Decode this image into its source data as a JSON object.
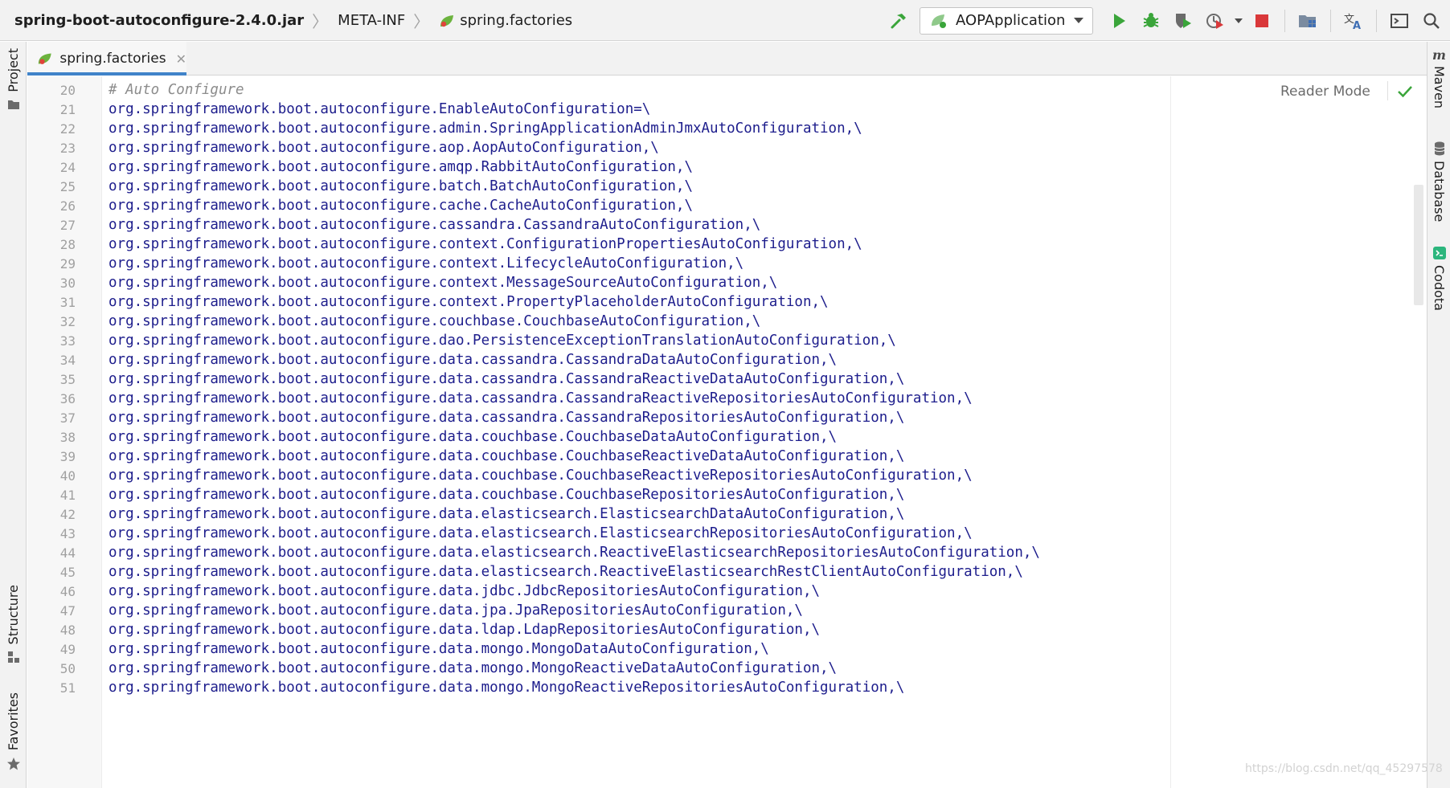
{
  "breadcrumb": {
    "items": [
      {
        "label": "spring-boot-autoconfigure-2.4.0.jar"
      },
      {
        "label": "META-INF"
      },
      {
        "label": "spring.factories"
      }
    ]
  },
  "toolbar": {
    "run_config": "AOPApplication"
  },
  "left_strip": {
    "project": "Project",
    "structure": "Structure",
    "favorites": "Favorites"
  },
  "right_strip": {
    "maven": "Maven",
    "database": "Database",
    "codota": "Codota"
  },
  "editor_tab": {
    "label": "spring.factories"
  },
  "editor": {
    "reader_mode": "Reader Mode",
    "lines": [
      {
        "n": "20",
        "text": "# Auto Configure",
        "kind": "comment"
      },
      {
        "n": "21",
        "text": "org.springframework.boot.autoconfigure.EnableAutoConfiguration=\\"
      },
      {
        "n": "22",
        "text": "org.springframework.boot.autoconfigure.admin.SpringApplicationAdminJmxAutoConfiguration,\\"
      },
      {
        "n": "23",
        "text": "org.springframework.boot.autoconfigure.aop.AopAutoConfiguration,\\"
      },
      {
        "n": "24",
        "text": "org.springframework.boot.autoconfigure.amqp.RabbitAutoConfiguration,\\"
      },
      {
        "n": "25",
        "text": "org.springframework.boot.autoconfigure.batch.BatchAutoConfiguration,\\"
      },
      {
        "n": "26",
        "text": "org.springframework.boot.autoconfigure.cache.CacheAutoConfiguration,\\"
      },
      {
        "n": "27",
        "text": "org.springframework.boot.autoconfigure.cassandra.CassandraAutoConfiguration,\\"
      },
      {
        "n": "28",
        "text": "org.springframework.boot.autoconfigure.context.ConfigurationPropertiesAutoConfiguration,\\"
      },
      {
        "n": "29",
        "text": "org.springframework.boot.autoconfigure.context.LifecycleAutoConfiguration,\\"
      },
      {
        "n": "30",
        "text": "org.springframework.boot.autoconfigure.context.MessageSourceAutoConfiguration,\\"
      },
      {
        "n": "31",
        "text": "org.springframework.boot.autoconfigure.context.PropertyPlaceholderAutoConfiguration,\\"
      },
      {
        "n": "32",
        "text": "org.springframework.boot.autoconfigure.couchbase.CouchbaseAutoConfiguration,\\"
      },
      {
        "n": "33",
        "text": "org.springframework.boot.autoconfigure.dao.PersistenceExceptionTranslationAutoConfiguration,\\"
      },
      {
        "n": "34",
        "text": "org.springframework.boot.autoconfigure.data.cassandra.CassandraDataAutoConfiguration,\\"
      },
      {
        "n": "35",
        "text": "org.springframework.boot.autoconfigure.data.cassandra.CassandraReactiveDataAutoConfiguration,\\"
      },
      {
        "n": "36",
        "text": "org.springframework.boot.autoconfigure.data.cassandra.CassandraReactiveRepositoriesAutoConfiguration,\\"
      },
      {
        "n": "37",
        "text": "org.springframework.boot.autoconfigure.data.cassandra.CassandraRepositoriesAutoConfiguration,\\"
      },
      {
        "n": "38",
        "text": "org.springframework.boot.autoconfigure.data.couchbase.CouchbaseDataAutoConfiguration,\\"
      },
      {
        "n": "39",
        "text": "org.springframework.boot.autoconfigure.data.couchbase.CouchbaseReactiveDataAutoConfiguration,\\"
      },
      {
        "n": "40",
        "text": "org.springframework.boot.autoconfigure.data.couchbase.CouchbaseReactiveRepositoriesAutoConfiguration,\\"
      },
      {
        "n": "41",
        "text": "org.springframework.boot.autoconfigure.data.couchbase.CouchbaseRepositoriesAutoConfiguration,\\"
      },
      {
        "n": "42",
        "text": "org.springframework.boot.autoconfigure.data.elasticsearch.ElasticsearchDataAutoConfiguration,\\"
      },
      {
        "n": "43",
        "text": "org.springframework.boot.autoconfigure.data.elasticsearch.ElasticsearchRepositoriesAutoConfiguration,\\"
      },
      {
        "n": "44",
        "text": "org.springframework.boot.autoconfigure.data.elasticsearch.ReactiveElasticsearchRepositoriesAutoConfiguration,\\"
      },
      {
        "n": "45",
        "text": "org.springframework.boot.autoconfigure.data.elasticsearch.ReactiveElasticsearchRestClientAutoConfiguration,\\"
      },
      {
        "n": "46",
        "text": "org.springframework.boot.autoconfigure.data.jdbc.JdbcRepositoriesAutoConfiguration,\\"
      },
      {
        "n": "47",
        "text": "org.springframework.boot.autoconfigure.data.jpa.JpaRepositoriesAutoConfiguration,\\"
      },
      {
        "n": "48",
        "text": "org.springframework.boot.autoconfigure.data.ldap.LdapRepositoriesAutoConfiguration,\\"
      },
      {
        "n": "49",
        "text": "org.springframework.boot.autoconfigure.data.mongo.MongoDataAutoConfiguration,\\"
      },
      {
        "n": "50",
        "text": "org.springframework.boot.autoconfigure.data.mongo.MongoReactiveDataAutoConfiguration,\\"
      },
      {
        "n": "51",
        "text": "org.springframework.boot.autoconfigure.data.mongo.MongoReactiveRepositoriesAutoConfiguration,\\"
      }
    ]
  },
  "watermark": "https://blog.csdn.net/qq_45297578",
  "colors": {
    "code_text": "#1d1d8c",
    "comment": "#8c8c8c",
    "run_green": "#3aa53a",
    "stop_red": "#d9383a",
    "tab_underline": "#4083c9"
  }
}
